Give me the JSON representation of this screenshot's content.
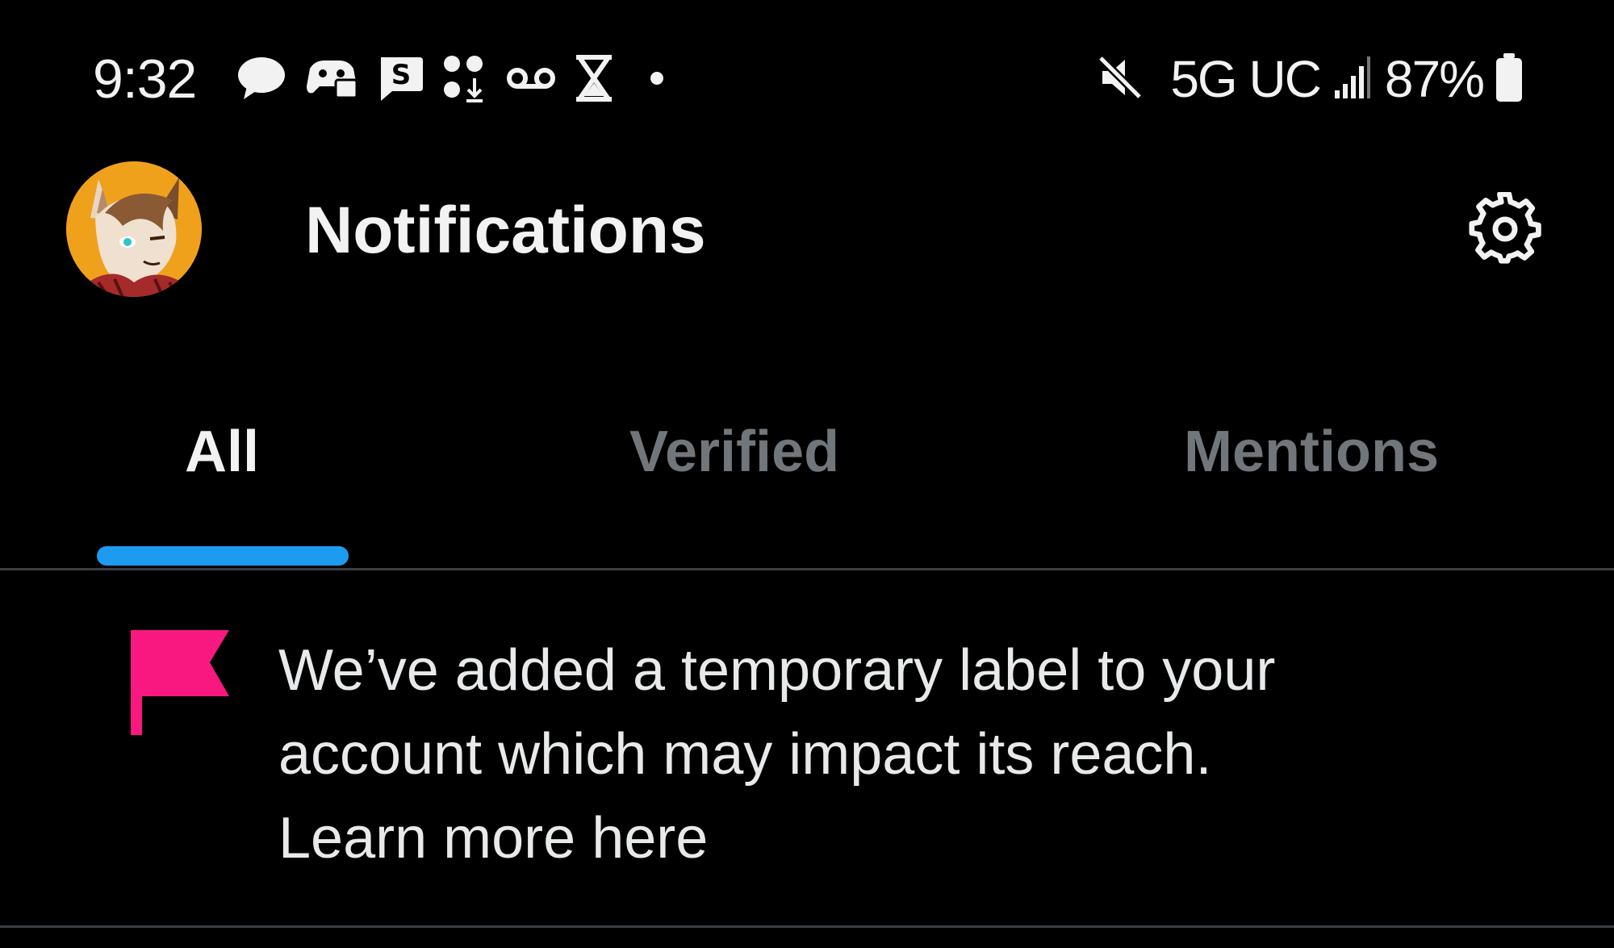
{
  "status_bar": {
    "time": "9:32",
    "left_icons": [
      "messages-icon",
      "discord-icon",
      "s-app-icon",
      "dots-download-icon",
      "voicemail-icon",
      "hourglass-icon",
      "dot-icon"
    ],
    "mute_icon": "mute-icon",
    "network": "5G UC",
    "signal_icon": "signal-icon",
    "battery": "87%",
    "battery_icon": "battery-icon"
  },
  "header": {
    "title": "Notifications",
    "avatar_icon": "avatar",
    "settings_icon": "gear-icon"
  },
  "tabs": [
    {
      "label": "All",
      "active": true
    },
    {
      "label": "Verified",
      "active": false
    },
    {
      "label": "Mentions",
      "active": false
    }
  ],
  "notice": {
    "icon": "flag-icon",
    "message": "We’ve added a temporary label to your account which may impact its reach.",
    "link": "Learn more here"
  },
  "colors": {
    "background": "#000000",
    "accent": "#1d9bf0",
    "flag": "#f91880",
    "inactive_tab": "#71767b",
    "avatar_bg": "#f0a11b"
  }
}
